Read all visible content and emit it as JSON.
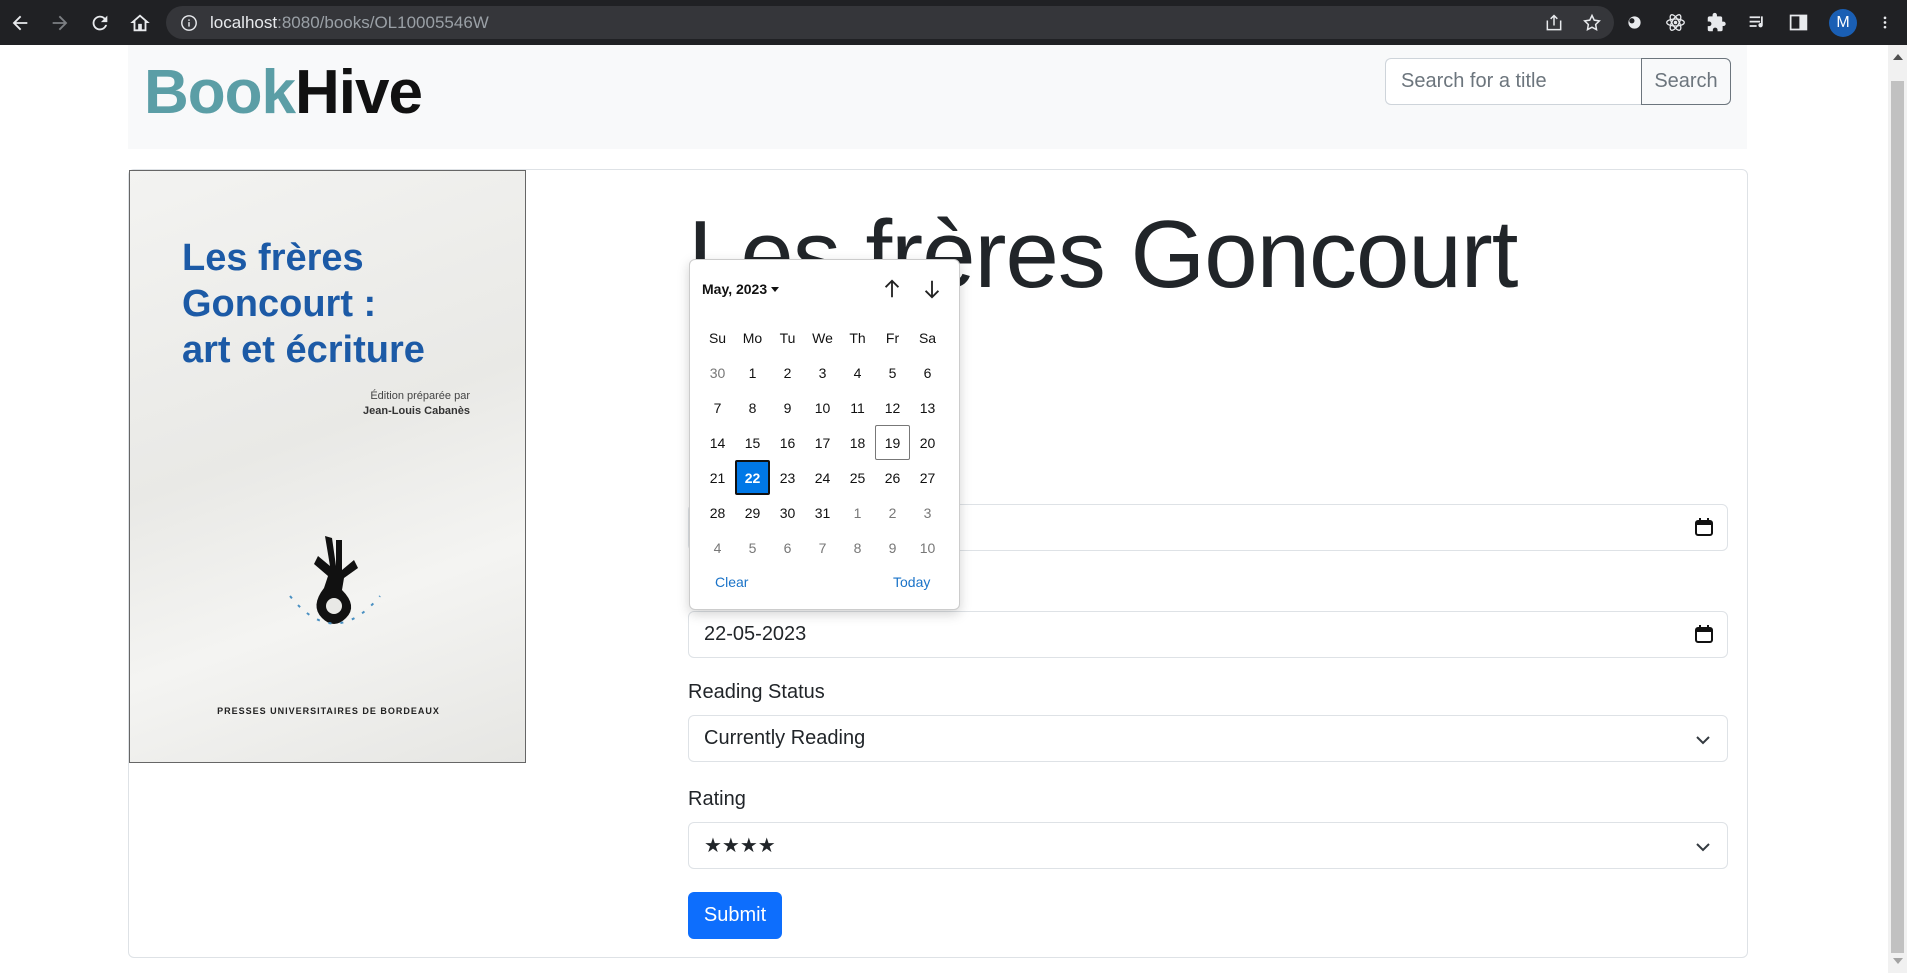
{
  "browser": {
    "url_host": "localhost",
    "url_path": ":8080/books/OL10005546W",
    "profile_initial": "M"
  },
  "header": {
    "logo_part1": "Book",
    "logo_part2": "Hive",
    "search_placeholder": "Search for a title",
    "search_button": "Search"
  },
  "cover": {
    "title_lines": [
      "Les frères",
      "Goncourt :",
      "art et écriture"
    ],
    "edition_line1": "Édition préparée par",
    "edition_line2": "Jean-Louis Cabanès",
    "publisher": "PRESSES UNIVERSITAIRES DE BORDEAUX"
  },
  "book": {
    "title": "Les frères Goncourt"
  },
  "form": {
    "start_date_value": "",
    "finish_date_value": "22-05-2023",
    "reading_status_label": "Reading Status",
    "reading_status_value": "Currently Reading",
    "rating_label": "Rating",
    "rating_value": "★★★★",
    "submit_label": "Submit"
  },
  "datepicker": {
    "month_label": "May, 2023",
    "weekdays": [
      "Su",
      "Mo",
      "Tu",
      "We",
      "Th",
      "Fr",
      "Sa"
    ],
    "days": [
      {
        "d": "30",
        "other": true
      },
      {
        "d": "1"
      },
      {
        "d": "2"
      },
      {
        "d": "3"
      },
      {
        "d": "4"
      },
      {
        "d": "5"
      },
      {
        "d": "6"
      },
      {
        "d": "7"
      },
      {
        "d": "8"
      },
      {
        "d": "9"
      },
      {
        "d": "10"
      },
      {
        "d": "11"
      },
      {
        "d": "12"
      },
      {
        "d": "13"
      },
      {
        "d": "14"
      },
      {
        "d": "15"
      },
      {
        "d": "16"
      },
      {
        "d": "17"
      },
      {
        "d": "18"
      },
      {
        "d": "19",
        "today": true
      },
      {
        "d": "20"
      },
      {
        "d": "21"
      },
      {
        "d": "22",
        "selected": true
      },
      {
        "d": "23"
      },
      {
        "d": "24"
      },
      {
        "d": "25"
      },
      {
        "d": "26"
      },
      {
        "d": "27"
      },
      {
        "d": "28"
      },
      {
        "d": "29"
      },
      {
        "d": "30"
      },
      {
        "d": "31"
      },
      {
        "d": "1",
        "other": true
      },
      {
        "d": "2",
        "other": true
      },
      {
        "d": "3",
        "other": true
      },
      {
        "d": "4",
        "other": true
      },
      {
        "d": "5",
        "other": true
      },
      {
        "d": "6",
        "other": true
      },
      {
        "d": "7",
        "other": true
      },
      {
        "d": "8",
        "other": true
      },
      {
        "d": "9",
        "other": true
      },
      {
        "d": "10",
        "other": true
      }
    ],
    "clear_label": "Clear",
    "today_label": "Today"
  }
}
